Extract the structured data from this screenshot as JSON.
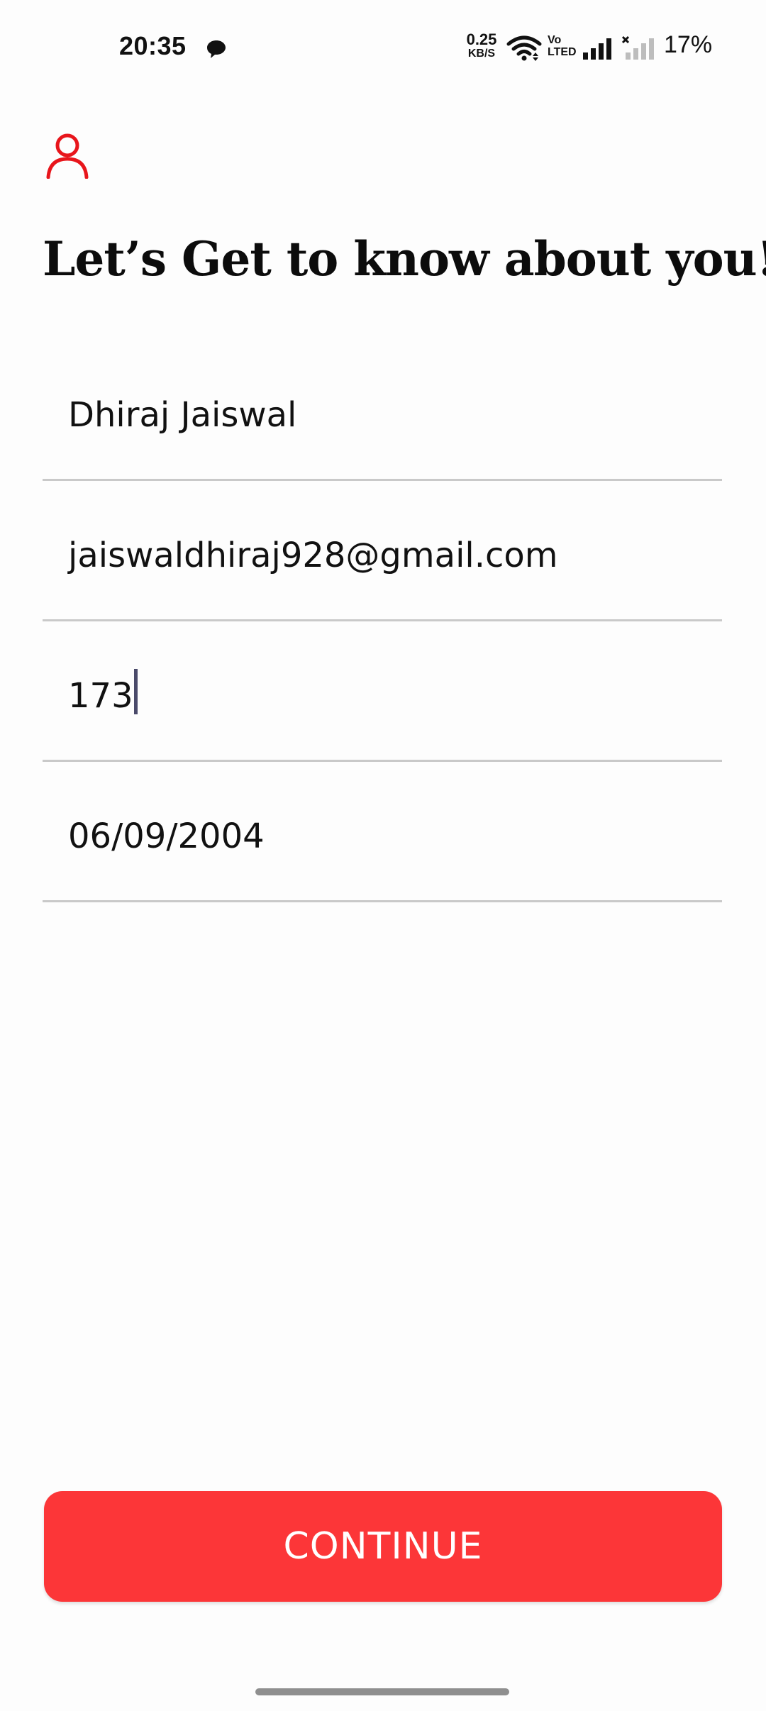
{
  "status_bar": {
    "time": "20:35",
    "net_speed_value": "0.25",
    "net_speed_unit": "KB/S",
    "volte_top": "Vo",
    "volte_bottom": "LTED",
    "battery": "17%",
    "icons": [
      "message-icon",
      "wifi-icon",
      "signal-icon",
      "signal-no-service-icon"
    ]
  },
  "header": {
    "icon": "profile-icon",
    "icon_color": "#e8151b",
    "title": "Let’s Get to know about you!"
  },
  "form": {
    "name": "Dhiraj Jaiswal",
    "email": "jaiswaldhiraj928@gmail.com",
    "height": "173",
    "dob": "06/09/2004"
  },
  "button": {
    "label": "CONTINUE",
    "color": "#fc3638"
  }
}
